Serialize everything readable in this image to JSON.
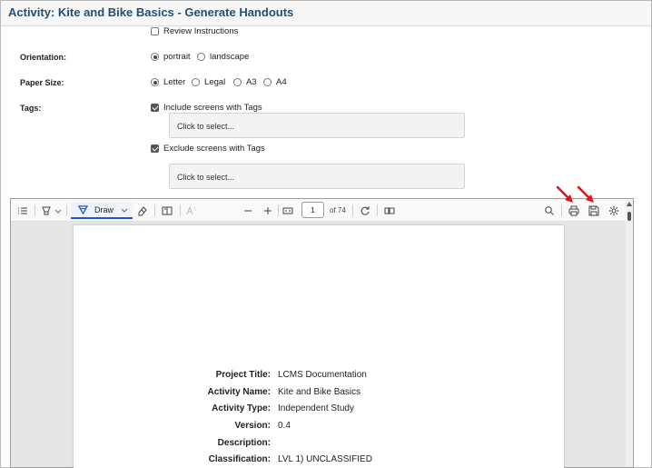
{
  "header": {
    "title": "Activity: Kite and Bike Basics - Generate Handouts"
  },
  "form": {
    "review_instructions": {
      "label": "Review Instructions",
      "checked": false
    },
    "orientation": {
      "label": "Orientation:",
      "options": [
        {
          "label": "portrait",
          "selected": true
        },
        {
          "label": "landscape",
          "selected": false
        }
      ]
    },
    "paper_size": {
      "label": "Paper Size:",
      "options": [
        {
          "label": "Letter",
          "selected": true
        },
        {
          "label": "Legal",
          "selected": false
        },
        {
          "label": "A3",
          "selected": false
        },
        {
          "label": "A4",
          "selected": false
        }
      ]
    },
    "tags": {
      "label": "Tags:",
      "include": {
        "label": "Include screens with Tags",
        "checked": true,
        "placeholder": "Click to select..."
      },
      "exclude": {
        "label": "Exclude screens with Tags",
        "checked": true,
        "placeholder": "Click to select..."
      }
    }
  },
  "viewer": {
    "toolbar": {
      "draw_label": "Draw",
      "page_number": "1",
      "of_pages": "of 74",
      "icons": [
        "contents-icon",
        "highlight-icon",
        "draw-icon",
        "eraser-icon",
        "text-icon",
        "read-aloud-icon",
        "zoom-out-icon",
        "zoom-in-icon",
        "fit-page-icon",
        "rotate-icon",
        "page-view-icon",
        "search-icon",
        "print-icon",
        "save-icon",
        "settings-icon"
      ]
    },
    "document": {
      "rows": [
        {
          "key": "Project Title:",
          "value": "LCMS Documentation"
        },
        {
          "key": "Activity Name:",
          "value": "Kite and Bike Basics"
        },
        {
          "key": "Activity Type:",
          "value": "Independent Study"
        },
        {
          "key": "Version:",
          "value": "0.4"
        },
        {
          "key": "Description:",
          "value": ""
        },
        {
          "key": "Classification:",
          "value": "LVL 1) UNCLASSIFIED"
        }
      ]
    }
  },
  "colors": {
    "title": "#1f4e79",
    "accent": "#1a5bc4",
    "arrow": "#e0141b"
  }
}
